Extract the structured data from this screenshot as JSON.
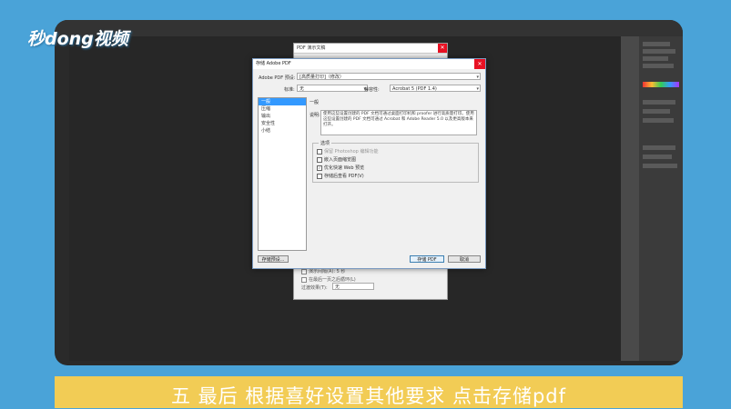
{
  "logo": "秒dong视频",
  "caption": "五  最后  根据喜好设置其他要求  点击存储pdf",
  "back_dialog": {
    "title": "PDF 演示文稿",
    "rows": [
      "演示间隔(A):  5   秒",
      "在最后一页之后循环(L)"
    ],
    "transition_label": "过渡效果(T):",
    "transition_value": "无"
  },
  "dialog": {
    "title": "存储 Adobe PDF",
    "preset_label": "Adobe PDF 预设:",
    "preset_value": "[高质量打印]（修改）",
    "standard_label": "标准:",
    "standard_value": "无",
    "compat_label": "兼容性:",
    "compat_value": "Acrobat 5 (PDF 1.4)",
    "sidebar": [
      "一般",
      "压缩",
      "输出",
      "安全性",
      "小结"
    ],
    "section_title": "一般",
    "desc_label": "说明:",
    "description": "使用这些设置创建的 PDF 文档可通过桌面打印机和 proofer 进行高质量打印。使用这些设置创建的 PDF 文档可通过 Acrobat 和 Adobe Reader 5.0 以及更高版本来打开。",
    "options_title": "选项",
    "options": [
      {
        "label": "保留 Photoshop 编辑功能",
        "checked": false,
        "disabled": true
      },
      {
        "label": "嵌入页面缩览图",
        "checked": false,
        "disabled": false
      },
      {
        "label": "优化快速 Web 预览",
        "checked": true,
        "disabled": false
      },
      {
        "label": "存储后查看 PDF(V)",
        "checked": false,
        "disabled": false
      }
    ],
    "save_preset_button": "存储预设...",
    "save_pdf_button": "存储 PDF",
    "cancel_button": "取消"
  }
}
